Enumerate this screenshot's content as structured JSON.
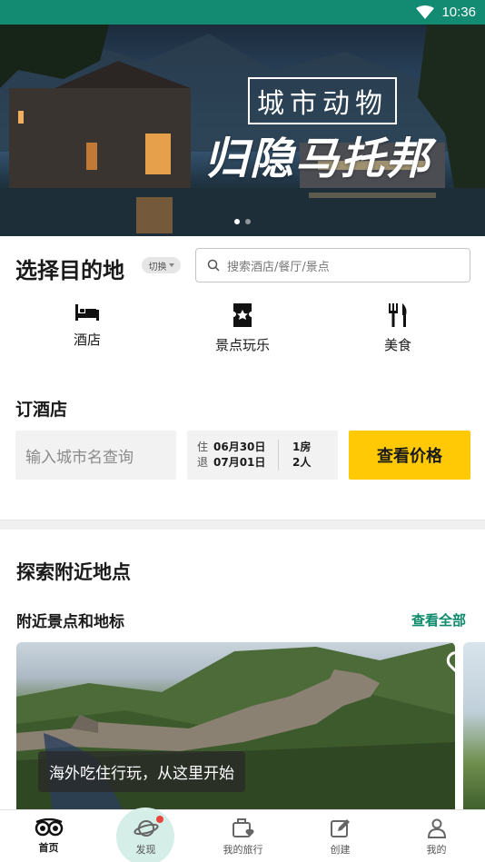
{
  "status_bar": {
    "time": "10:36",
    "icons": [
      "wifi-icon",
      "battery-icon"
    ]
  },
  "hero": {
    "title_small": "城市动物",
    "title_large": "归隐马托邦",
    "slide_count": 2,
    "active_slide": 1
  },
  "destination": {
    "title": "选择目的地",
    "switch_label": "切换",
    "search_placeholder": "搜索酒店/餐厅/景点"
  },
  "categories": [
    {
      "label": "酒店",
      "icon": "bed-icon"
    },
    {
      "label": "景点玩乐",
      "icon": "ticket-icon"
    },
    {
      "label": "美食",
      "icon": "fork-knife-icon"
    }
  ],
  "hotel": {
    "title": "订酒店",
    "city_placeholder": "输入城市名查询",
    "checkin_label": "住",
    "checkout_label": "退",
    "checkin_date": "06月30日",
    "checkout_date": "07月01日",
    "rooms": "1房",
    "guests": "2人",
    "button_label": "查看价格"
  },
  "explore": {
    "title": "探索附近地点",
    "section_title": "附近景点和地标",
    "see_all": "查看全部",
    "card_caption": "海外吃住行玩，从这里开始"
  },
  "bottom_nav": [
    {
      "label": "首页",
      "icon": "owl-icon",
      "active": true
    },
    {
      "label": "发现",
      "icon": "planet-icon",
      "active": false
    },
    {
      "label": "我的旅行",
      "icon": "suitcase-heart-icon",
      "active": false
    },
    {
      "label": "创建",
      "icon": "edit-icon",
      "active": false
    },
    {
      "label": "我的",
      "icon": "user-icon",
      "active": false
    }
  ],
  "colors": {
    "status_bar": "#138a72",
    "accent_green": "#0e8a6c",
    "cta_yellow": "#ffca05"
  }
}
